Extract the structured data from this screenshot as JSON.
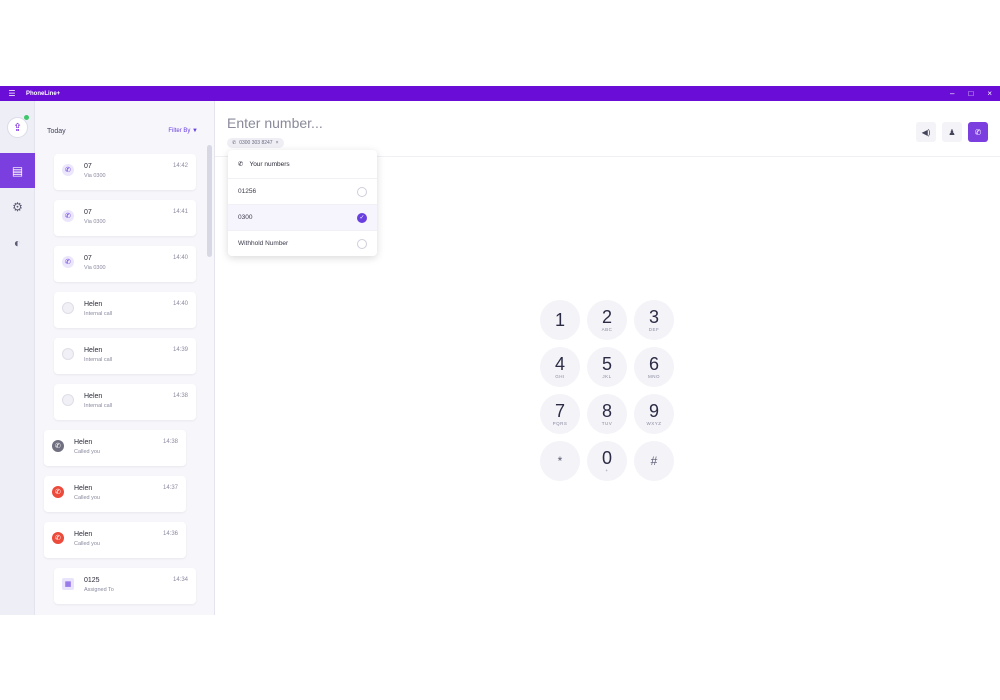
{
  "titlebar": {
    "app_name": "PhoneLine+",
    "menu_icon": "hamburger-icon",
    "minimize": "–",
    "maximize": "□",
    "close": "×"
  },
  "rail": {
    "avatar_icon": "upload-user-icon",
    "items": [
      {
        "name": "calls",
        "icon": "phone-list-icon",
        "glyph": "▤"
      },
      {
        "name": "settings",
        "icon": "gear-icon",
        "glyph": "⚙"
      },
      {
        "name": "sign-out",
        "icon": "power-icon",
        "glyph": "◐"
      }
    ]
  },
  "list": {
    "heading": "Today",
    "filter_label": "Filter By",
    "filter_icon": "▼",
    "items": [
      {
        "name": "07",
        "sub": "Via 0300",
        "time": "14:42",
        "icon": "call",
        "glyph": "✆"
      },
      {
        "name": "07",
        "sub": "Via 0300",
        "time": "14:41",
        "icon": "call",
        "glyph": "✆"
      },
      {
        "name": "07",
        "sub": "Via 0300",
        "time": "14:40",
        "icon": "call",
        "glyph": "✆"
      },
      {
        "name": "Helen",
        "sub": "Internal call",
        "time": "14:40",
        "icon": "internal",
        "glyph": ""
      },
      {
        "name": "Helen",
        "sub": "Internal call",
        "time": "14:39",
        "icon": "internal",
        "glyph": ""
      },
      {
        "name": "Helen",
        "sub": "Internal call",
        "time": "14:38",
        "icon": "internal",
        "glyph": ""
      },
      {
        "name": "Helen",
        "sub": "Called you",
        "time": "14:38",
        "icon": "grey",
        "glyph": "✆"
      },
      {
        "name": "Helen",
        "sub": "Called you",
        "time": "14:37",
        "icon": "red",
        "glyph": "✆"
      },
      {
        "name": "Helen",
        "sub": "Called you",
        "time": "14:36",
        "icon": "red",
        "glyph": "✆"
      },
      {
        "name": "0125",
        "sub": "Assigned To",
        "time": "14:34",
        "icon": "box",
        "glyph": "▦"
      }
    ]
  },
  "dialer": {
    "placeholder": "Enter number...",
    "chip_label": "0300 303 8247",
    "chip_close": "×",
    "toolbar": {
      "speaker": "◀)",
      "contact": "♟",
      "call": "✆"
    },
    "dropdown": {
      "title": "Your numbers",
      "options": [
        {
          "label": "01256",
          "selected": false
        },
        {
          "label": "0300",
          "selected": true
        },
        {
          "label": "Withhold Number",
          "selected": false
        }
      ],
      "check": "✓"
    },
    "keys": [
      {
        "d": "1",
        "l": ""
      },
      {
        "d": "2",
        "l": "ABC"
      },
      {
        "d": "3",
        "l": "DEF"
      },
      {
        "d": "4",
        "l": "GHI"
      },
      {
        "d": "5",
        "l": "JKL"
      },
      {
        "d": "6",
        "l": "MNO"
      },
      {
        "d": "7",
        "l": "PQRS"
      },
      {
        "d": "8",
        "l": "TUV"
      },
      {
        "d": "9",
        "l": "WXYZ"
      },
      {
        "d": "*",
        "l": ""
      },
      {
        "d": "0",
        "l": "+"
      },
      {
        "d": "#",
        "l": ""
      }
    ]
  }
}
